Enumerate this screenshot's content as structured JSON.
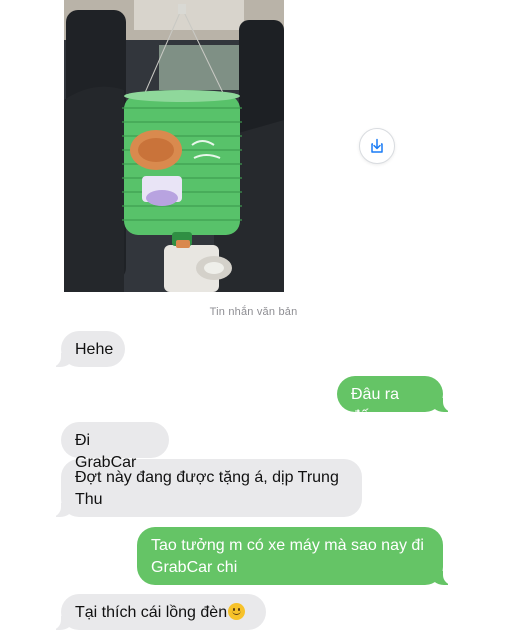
{
  "conversation": {
    "timestamp_label": "Tin nhắn văn bản",
    "messages": [
      {
        "direction": "incoming",
        "text": "Hehe"
      },
      {
        "direction": "outgoing",
        "text": "Đâu ra đấy"
      },
      {
        "direction": "incoming",
        "text": "Đi GrabCar"
      },
      {
        "direction": "incoming",
        "text": "Đợt này đang được tặng á, dịp Trung Thu"
      },
      {
        "direction": "outgoing",
        "text": "Tao tưởng m có xe máy mà sao nay đi GrabCar chi"
      },
      {
        "direction": "incoming",
        "text": "Tại thích cái lồng đèn",
        "trailing_emoji": "slightly-smiling-face"
      }
    ]
  },
  "attachment": {
    "type": "image",
    "save_icon": "save-download-icon"
  },
  "colors": {
    "incoming_bubble": "#e9e9eb",
    "outgoing_bubble": "#65c466",
    "incoming_text": "#111111",
    "outgoing_text": "#ffffff",
    "timestamp_text": "#8e8e93"
  }
}
